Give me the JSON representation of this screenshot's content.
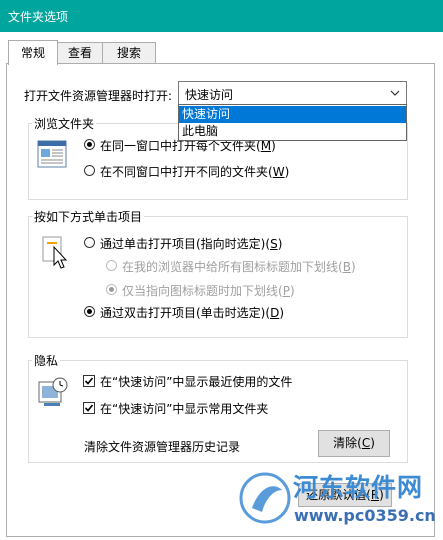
{
  "window": {
    "title": "文件夹选项"
  },
  "tabs": [
    {
      "label": "常规",
      "active": true
    },
    {
      "label": "查看",
      "active": false
    },
    {
      "label": "搜索",
      "active": false
    }
  ],
  "open_explorer": {
    "label": "打开文件资源管理器时打开:",
    "selected": "快速访问",
    "options": [
      "快速访问",
      "此电脑"
    ]
  },
  "browse_folders": {
    "title": "浏览文件夹",
    "options": [
      {
        "label": "在同一窗口中打开每个文件夹",
        "key": "M",
        "selected": true
      },
      {
        "label": "在不同窗口中打开不同的文件夹",
        "key": "W",
        "selected": false
      }
    ]
  },
  "click_items": {
    "title": "按如下方式单击项目",
    "options": [
      {
        "label": "通过单击打开项目(指向时选定)",
        "key": "S",
        "selected": false
      },
      {
        "label": "在我的浏览器中给所有图标标题加下划线",
        "key": "B",
        "selected": false,
        "disabled": true
      },
      {
        "label": "仅当指向图标标题时加下划线",
        "key": "P",
        "selected": true,
        "disabled": true
      },
      {
        "label": "通过双击打开项目(单击时选定)",
        "key": "D",
        "selected": true
      }
    ]
  },
  "privacy": {
    "title": "隐私",
    "checks": [
      {
        "label": "在“快速访问”中显示最近使用的文件",
        "checked": true
      },
      {
        "label": "在“快速访问”中显示常用文件夹",
        "checked": true
      }
    ],
    "clear_label": "清除文件资源管理器历史记录",
    "clear_button": "清除",
    "clear_key": "C"
  },
  "restore_button": {
    "label": "还原默认值",
    "key": "R"
  },
  "watermark": {
    "line1": "河东软件网",
    "line2": "www.pc0359.cn"
  },
  "colors": {
    "titlebar": "#00a69e",
    "selection": "#0078d7"
  }
}
